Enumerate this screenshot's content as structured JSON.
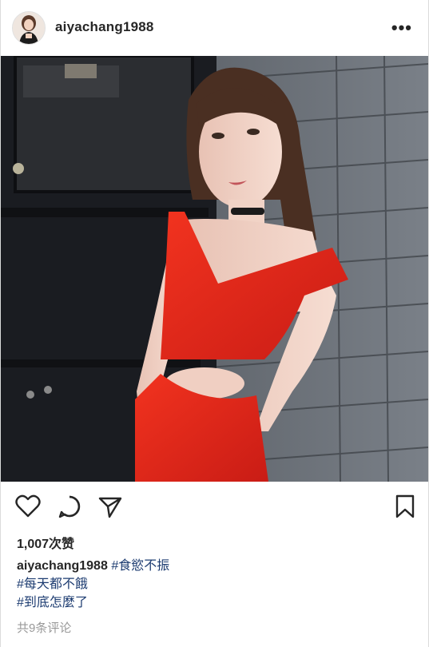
{
  "header": {
    "username": "aiyachang1988",
    "more_label": "•••"
  },
  "icons": {
    "like": "heart-icon",
    "comment": "comment-bubble-icon",
    "share": "paper-plane-icon",
    "save": "bookmark-icon"
  },
  "post": {
    "likes": "1,007次赞",
    "caption_user": "aiyachang1988",
    "tags": [
      "#食慾不振",
      "#每天都不餓",
      "#到底怎麼了"
    ],
    "comments": "共9条评论"
  },
  "colors": {
    "dress": "#e3241b",
    "hashtag": "#1d3c71",
    "muted": "#999999"
  }
}
